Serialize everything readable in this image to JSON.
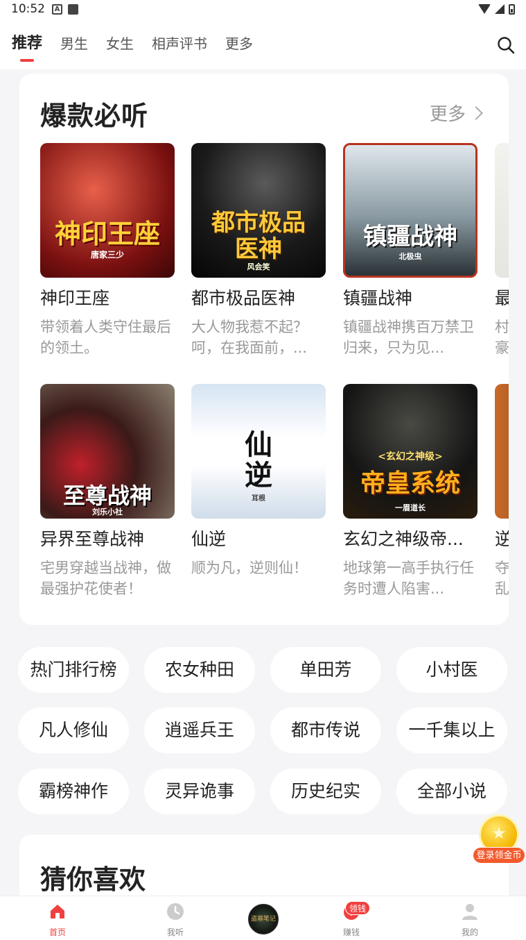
{
  "status_bar": {
    "time": "10:52",
    "a_icon": "A"
  },
  "top_nav": {
    "tabs": [
      {
        "label": "推荐",
        "active": true
      },
      {
        "label": "男生"
      },
      {
        "label": "女生"
      },
      {
        "label": "相声评书"
      },
      {
        "label": "更多"
      }
    ]
  },
  "hot": {
    "title": "爆款必听",
    "more_label": "更多",
    "books": [
      {
        "title": "神印王座",
        "desc": "带领着人类守住最后的领土。",
        "cover_text": "神印王座",
        "cover_author": "唐家三少",
        "colors": [
          "#7a1010",
          "#d83a2a"
        ]
      },
      {
        "title": "都市极品医神",
        "desc": "大人物我惹不起？呵，在我面前，...",
        "cover_text": "都市极品医神",
        "cover_author": "风会笑",
        "colors": [
          "#0a0a0a",
          "#3a3a3a"
        ]
      },
      {
        "title": "镇疆战神",
        "desc": "镇疆战神携百万禁卫归来，只为见...",
        "cover_text": "镇疆战神",
        "cover_author": "北极虫",
        "colors": [
          "#c9d4da",
          "#5a6b72"
        ]
      },
      {
        "title": "最",
        "desc": "村豪",
        "cover_text": "",
        "cover_author": "",
        "colors": [
          "#eeeeee",
          "#dcdcdc"
        ]
      },
      {
        "title": "异界至尊战神",
        "desc": "宅男穿越当战神，做最强护花使者！",
        "cover_text": "至尊战神",
        "cover_author": "刘乐小社",
        "colors": [
          "#2a1818",
          "#8a6a5a"
        ]
      },
      {
        "title": "仙逆",
        "desc": "顺为凡，逆则仙！",
        "cover_text": "仙逆",
        "cover_author": "耳根",
        "colors": [
          "#dfe9f4",
          "#ffffff"
        ]
      },
      {
        "title": "玄幻之神级帝...",
        "desc": "地球第一高手执行任务时遭人陷害...",
        "cover_text": "帝皇系统",
        "cover_sub": "<玄幻之神级>",
        "cover_author": "一眉道长",
        "colors": [
          "#121212",
          "#3b2a18"
        ]
      },
      {
        "title": "逆",
        "desc": "夺乱",
        "cover_text": "",
        "cover_author": "",
        "colors": [
          "#c86a2a",
          "#2a1a10"
        ]
      }
    ]
  },
  "tags": [
    "热门排行榜",
    "农女种田",
    "单田芳",
    "小村医",
    "凡人修仙",
    "逍遥兵王",
    "都市传说",
    "一千集以上",
    "霸榜神作",
    "灵异诡事",
    "历史纪实",
    "全部小说"
  ],
  "guess": {
    "title": "猜你喜欢"
  },
  "float_coin": {
    "label": "登录领金币"
  },
  "bottom_nav": {
    "items": [
      {
        "label": "首页",
        "active": true,
        "icon": "home-icon"
      },
      {
        "label": "我听",
        "icon": "clock-icon"
      },
      {
        "label": "",
        "icon": "disc-icon",
        "disc_text": "盗墓笔记"
      },
      {
        "label": "赚钱",
        "icon": "earn-icon",
        "badge": "领钱"
      },
      {
        "label": "我的",
        "icon": "user-icon"
      }
    ]
  },
  "colors": {
    "accent": "#f04040",
    "background": "#f5f5f7",
    "muted": "#999999"
  }
}
